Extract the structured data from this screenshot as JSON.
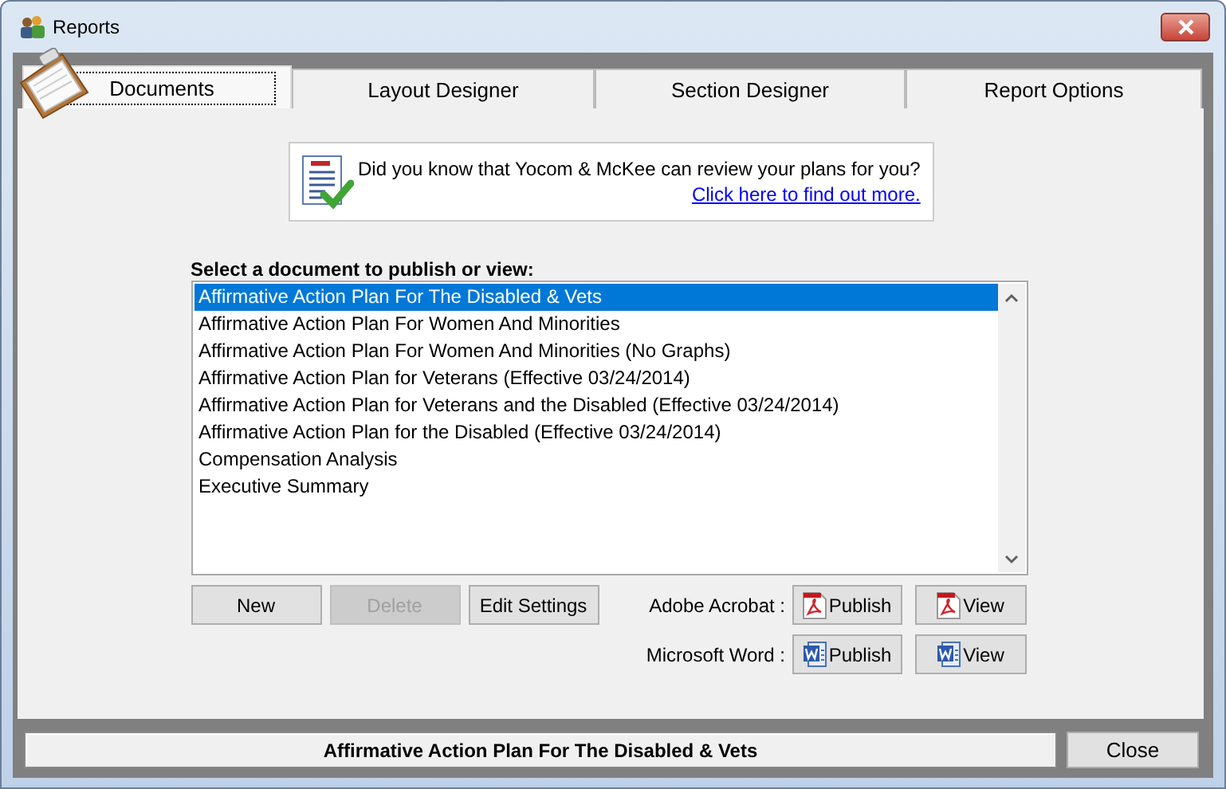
{
  "window": {
    "title": "Reports"
  },
  "tabs": [
    {
      "label": "Documents",
      "selected": true
    },
    {
      "label": "Layout Designer",
      "selected": false
    },
    {
      "label": "Section Designer",
      "selected": false
    },
    {
      "label": "Report Options",
      "selected": false
    }
  ],
  "tip": {
    "text": "Did you know that Yocom & McKee can review your plans for you?",
    "link": "Click here to find out more."
  },
  "document_list": {
    "label": "Select a document to publish or view:",
    "items": [
      {
        "label": "Affirmative Action Plan For The Disabled & Vets",
        "selected": true
      },
      {
        "label": "Affirmative Action Plan For Women And Minorities",
        "selected": false
      },
      {
        "label": "Affirmative Action Plan For Women And Minorities (No Graphs)",
        "selected": false
      },
      {
        "label": "Affirmative Action Plan for Veterans (Effective 03/24/2014)",
        "selected": false
      },
      {
        "label": "Affirmative Action Plan for Veterans and the Disabled (Effective 03/24/2014)",
        "selected": false
      },
      {
        "label": "Affirmative Action Plan for the Disabled (Effective 03/24/2014)",
        "selected": false
      },
      {
        "label": "Compensation Analysis",
        "selected": false
      },
      {
        "label": "Executive Summary",
        "selected": false
      }
    ]
  },
  "buttons": [
    {
      "label": "New",
      "disabled": false
    },
    {
      "label": "Delete",
      "disabled": true
    },
    {
      "label": "Edit Settings",
      "disabled": false
    }
  ],
  "export_rows": [
    {
      "label": "Adobe Acrobat :",
      "kind": "pdf",
      "buttons": [
        "Publish",
        "View"
      ]
    },
    {
      "label": "Microsoft Word :",
      "kind": "word",
      "buttons": [
        "Publish",
        "View"
      ]
    }
  ],
  "status_bar": {
    "text": "Affirmative Action Plan For The Disabled & Vets"
  },
  "close_button": "Close"
}
